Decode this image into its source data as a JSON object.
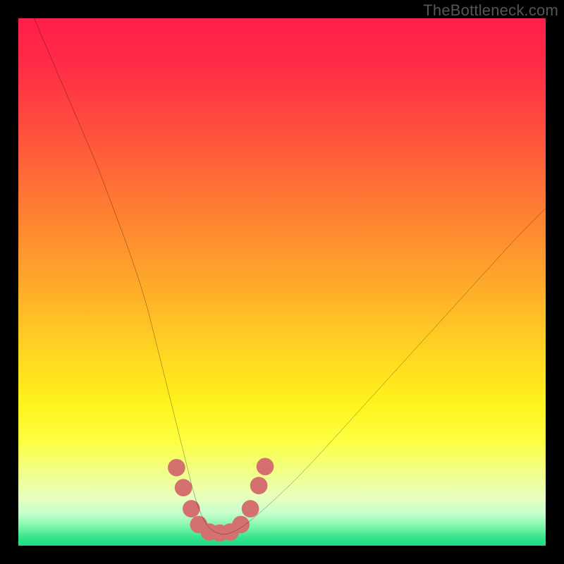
{
  "watermark": "TheBottleneck.com",
  "chart_data": {
    "type": "line",
    "title": "",
    "xlabel": "",
    "ylabel": "",
    "xlim": [
      0,
      100
    ],
    "ylim": [
      0,
      100
    ],
    "gradient_stops": [
      {
        "offset": 0.0,
        "color": "#ff1f49"
      },
      {
        "offset": 0.08,
        "color": "#ff2a47"
      },
      {
        "offset": 0.2,
        "color": "#ff4b3e"
      },
      {
        "offset": 0.35,
        "color": "#ff7a33"
      },
      {
        "offset": 0.5,
        "color": "#ffa82a"
      },
      {
        "offset": 0.63,
        "color": "#ffd422"
      },
      {
        "offset": 0.73,
        "color": "#fff31c"
      },
      {
        "offset": 0.8,
        "color": "#fdff40"
      },
      {
        "offset": 0.86,
        "color": "#f2ff87"
      },
      {
        "offset": 0.905,
        "color": "#eaffba"
      },
      {
        "offset": 0.938,
        "color": "#c8ffce"
      },
      {
        "offset": 0.962,
        "color": "#84f7ac"
      },
      {
        "offset": 0.985,
        "color": "#33e58e"
      },
      {
        "offset": 1.0,
        "color": "#1fd984"
      }
    ],
    "series": [
      {
        "name": "bottleneck-curve",
        "x": [
          3,
          6,
          9,
          12,
          15,
          18,
          21,
          24,
          26,
          28,
          30,
          32,
          33.5,
          35,
          36.5,
          38,
          39,
          40,
          42,
          45,
          50,
          55,
          60,
          65,
          70,
          75,
          80,
          85,
          90,
          95,
          100
        ],
        "y": [
          100,
          93,
          86,
          79,
          72,
          64,
          56,
          47,
          39,
          31,
          23,
          15,
          9,
          5,
          3,
          2.3,
          2.1,
          2.3,
          3.2,
          5.5,
          10,
          15,
          20.5,
          26,
          31.5,
          37,
          42.5,
          48,
          53.5,
          59,
          64
        ]
      }
    ],
    "markers": {
      "name": "highlight-dots",
      "color": "#d4716f",
      "radius_pct": 1.65,
      "points": [
        {
          "x": 30.0,
          "y": 14.8
        },
        {
          "x": 31.3,
          "y": 11.0
        },
        {
          "x": 32.8,
          "y": 7.0
        },
        {
          "x": 34.2,
          "y": 4.0
        },
        {
          "x": 36.2,
          "y": 2.6
        },
        {
          "x": 38.2,
          "y": 2.4
        },
        {
          "x": 40.2,
          "y": 2.6
        },
        {
          "x": 42.2,
          "y": 4.0
        },
        {
          "x": 44.0,
          "y": 7.0
        },
        {
          "x": 45.6,
          "y": 11.4
        },
        {
          "x": 46.8,
          "y": 15.0
        }
      ]
    },
    "legend": []
  }
}
